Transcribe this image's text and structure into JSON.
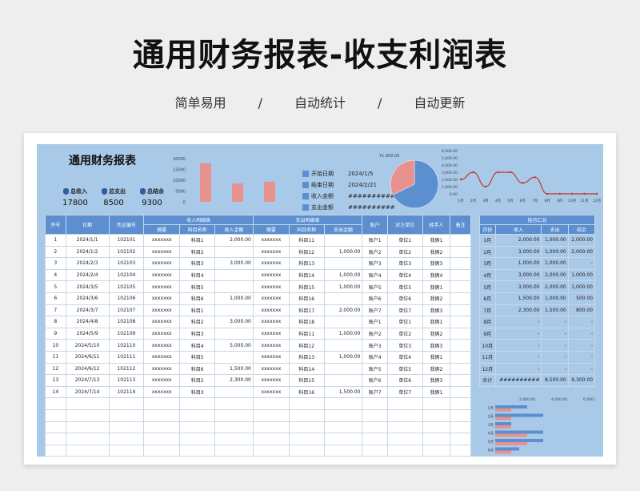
{
  "header": {
    "title": "通用财务报表-收支利润表",
    "tags": [
      "简单易用",
      "自动统计",
      "自动更新"
    ],
    "sep": "/"
  },
  "report": {
    "title": "通用财务报表",
    "totals": [
      {
        "label": "总收入",
        "value": "17800"
      },
      {
        "label": "总支出",
        "value": "8500"
      },
      {
        "label": "总结余",
        "value": "9300"
      }
    ],
    "info": [
      {
        "k": "开始日期",
        "v": "2024/1/5"
      },
      {
        "k": "结束日期",
        "v": "2024/2/21"
      },
      {
        "k": "收入金额",
        "v": "##########"
      },
      {
        "k": "支出金额",
        "v": "##########"
      }
    ]
  },
  "main_table": {
    "group_headers": [
      "序号",
      "日期",
      "凭证编号",
      "收入明细表",
      "支出明细表",
      "账户",
      "对方单位",
      "经手人",
      "备注"
    ],
    "sub_headers": [
      "摘要",
      "科目名称",
      "收入金额",
      "摘要",
      "科目名称",
      "支出金额"
    ],
    "rows": [
      [
        "1",
        "2024/1/1",
        "102101",
        "xxxxxxx",
        "科目1",
        "2,000.00",
        "xxxxxxx",
        "科目11",
        "",
        "账户1",
        "单位1",
        "我俩1"
      ],
      [
        "2",
        "2024/1/2",
        "102102",
        "xxxxxxx",
        "科目2",
        "",
        "xxxxxxx",
        "科目12",
        "1,000.00",
        "账户2",
        "单位2",
        "我俩2"
      ],
      [
        "3",
        "2024/2/3",
        "102103",
        "xxxxxxx",
        "科目3",
        "3,000.00",
        "xxxxxxx",
        "科目13",
        "",
        "账户3",
        "单位3",
        "我俩3"
      ],
      [
        "4",
        "2024/2/4",
        "102104",
        "xxxxxxx",
        "科目4",
        "",
        "xxxxxxx",
        "科目14",
        "1,000.00",
        "账户4",
        "单位4",
        "我俩4"
      ],
      [
        "5",
        "2024/3/5",
        "102105",
        "xxxxxxx",
        "科目5",
        "",
        "xxxxxxx",
        "科目15",
        "1,000.00",
        "账户5",
        "单位5",
        "我俩1"
      ],
      [
        "6",
        "2024/3/6",
        "102106",
        "xxxxxxx",
        "科目6",
        "1,000.00",
        "xxxxxxx",
        "科目16",
        "",
        "账户6",
        "单位6",
        "我俩2"
      ],
      [
        "7",
        "2024/3/7",
        "102107",
        "xxxxxxx",
        "科目1",
        "",
        "xxxxxxx",
        "科目17",
        "2,000.00",
        "账户7",
        "单位7",
        "我俩3"
      ],
      [
        "8",
        "2024/4/8",
        "102108",
        "xxxxxxx",
        "科目2",
        "3,000.00",
        "xxxxxxx",
        "科目18",
        "",
        "账户1",
        "单位1",
        "我俩1"
      ],
      [
        "9",
        "2024/5/9",
        "102109",
        "xxxxxxx",
        "科目3",
        "",
        "xxxxxxx",
        "科目11",
        "1,000.00",
        "账户2",
        "单位2",
        "我俩2"
      ],
      [
        "10",
        "2024/5/10",
        "102110",
        "xxxxxxx",
        "科目4",
        "5,000.00",
        "xxxxxxx",
        "科目12",
        "",
        "账户3",
        "单位3",
        "我俩3"
      ],
      [
        "11",
        "2024/6/11",
        "102111",
        "xxxxxxx",
        "科目5",
        "",
        "xxxxxxx",
        "科目13",
        "1,000.00",
        "账户4",
        "单位4",
        "我俩1"
      ],
      [
        "12",
        "2024/6/12",
        "102112",
        "xxxxxxx",
        "科目6",
        "1,500.00",
        "xxxxxxx",
        "科目14",
        "",
        "账户5",
        "单位5",
        "我俩2"
      ],
      [
        "13",
        "2024/7/13",
        "102113",
        "xxxxxxx",
        "科目2",
        "2,300.00",
        "xxxxxxx",
        "科目15",
        "",
        "账户6",
        "单位6",
        "我俩3"
      ],
      [
        "14",
        "2024/7/14",
        "102114",
        "xxxxxxx",
        "科目3",
        "",
        "xxxxxxx",
        "科目16",
        "1,500.00",
        "账户7",
        "单位7",
        "我俩1"
      ]
    ]
  },
  "monthly": {
    "title": "按月汇总",
    "headers": [
      "月份",
      "收入",
      "支出",
      "结余"
    ],
    "rows": [
      [
        "1月",
        "2,000.00",
        "1,000.00",
        "2,000.00"
      ],
      [
        "2月",
        "3,000.00",
        "1,000.00",
        "2,000.00"
      ],
      [
        "3月",
        "1,000.00",
        "1,000.00",
        "-"
      ],
      [
        "4月",
        "3,000.00",
        "2,000.00",
        "1,000.00"
      ],
      [
        "5月",
        "3,000.00",
        "2,000.00",
        "1,000.00"
      ],
      [
        "6月",
        "1,500.00",
        "1,000.00",
        "500.00"
      ],
      [
        "7月",
        "2,300.00",
        "1,500.00",
        "800.00"
      ],
      [
        "8月",
        "-",
        "-",
        "-"
      ],
      [
        "9月",
        "-",
        "-",
        "-"
      ],
      [
        "10月",
        "-",
        "-",
        "-"
      ],
      [
        "11月",
        "-",
        "-",
        "-"
      ],
      [
        "12月",
        "-",
        "-",
        "-"
      ],
      [
        "合计",
        "##########",
        "8,500.00",
        "9,300.00"
      ]
    ]
  },
  "colors": {
    "sheet": "#a9c9e9",
    "header": "#5b8fd0",
    "pink": "#e7928f",
    "line": "#c0392b"
  },
  "chart_data": [
    {
      "type": "bar",
      "categories": [
        "",
        "",
        ""
      ],
      "values": [
        17800,
        8500,
        9300
      ],
      "ylim": [
        0,
        20000
      ],
      "yticks": [
        "20000",
        "15000",
        "10000",
        "5000",
        "0"
      ]
    },
    {
      "type": "pie",
      "values": [
        17800,
        8500
      ],
      "labels": [
        "¥1,900.00",
        ""
      ]
    },
    {
      "type": "line",
      "categories": [
        "1月",
        "2月",
        "3月",
        "4月",
        "5月",
        "6月",
        "7月",
        "8月",
        "9月",
        "10月",
        "11月",
        "12月"
      ],
      "values": [
        2000,
        3000,
        1000,
        3000,
        3000,
        1500,
        2300,
        0,
        0,
        0,
        0,
        0
      ],
      "ylim": [
        0,
        6000
      ],
      "yticks": [
        "6,000.00",
        "5,000.00",
        "4,000.00",
        "3,000.00",
        "2,000.00",
        "1,000.00",
        "0.00"
      ]
    },
    {
      "type": "bar",
      "orientation": "horizontal",
      "categories": [
        "1月",
        "2月",
        "3月",
        "4月",
        "5月",
        "6月"
      ],
      "series": [
        {
          "values": [
            2000,
            3000,
            1000,
            3000,
            3000,
            1500
          ]
        },
        {
          "values": [
            1000,
            1000,
            1000,
            2000,
            2000,
            1000
          ]
        }
      ],
      "xticks": [
        "2,000.00",
        "4,000.00",
        "6,000.00"
      ]
    }
  ]
}
